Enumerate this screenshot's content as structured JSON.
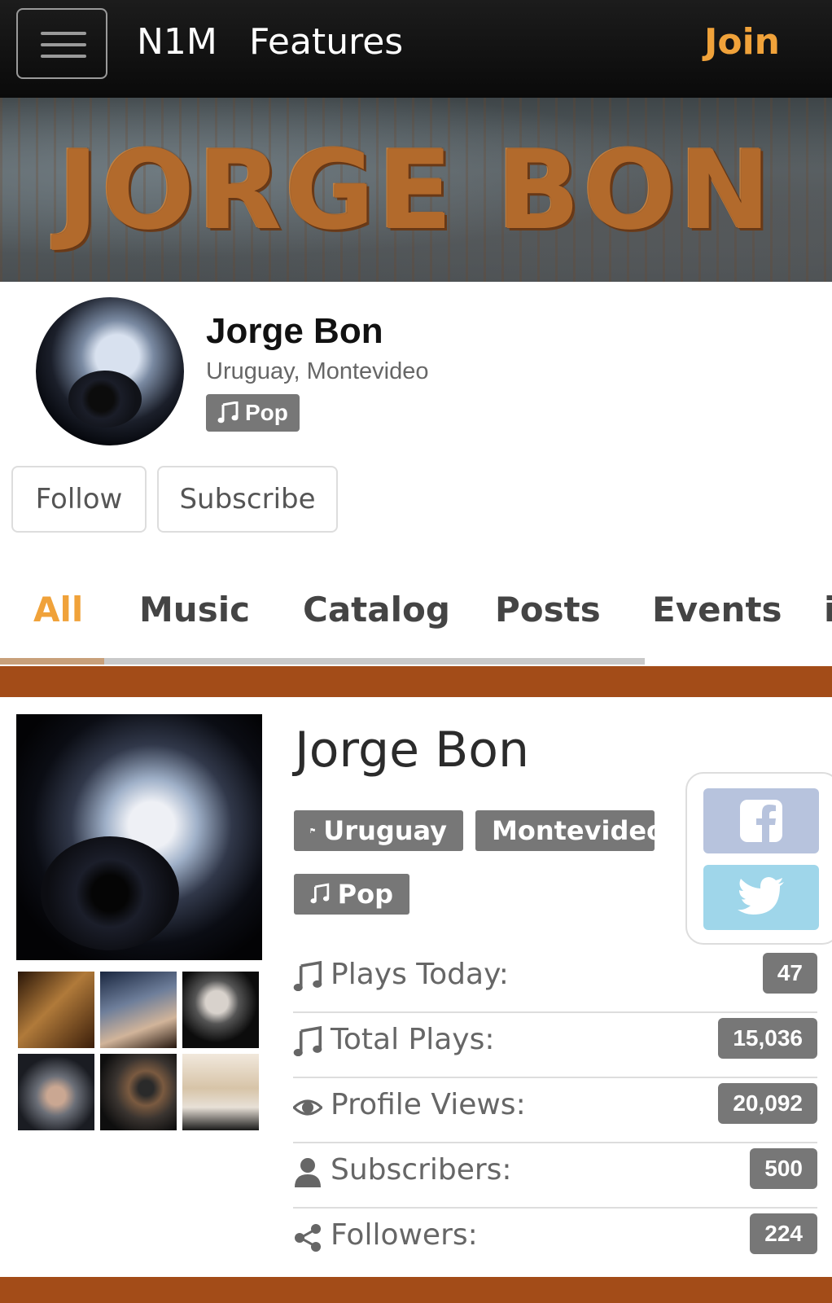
{
  "navbar": {
    "brand": "N1M",
    "features_label": "Features",
    "join_label": "Join"
  },
  "banner": {
    "title": "JORGE BON"
  },
  "profile": {
    "name": "Jorge Bon",
    "location": "Uruguay, Montevideo",
    "genre": "Pop",
    "follow_label": "Follow",
    "subscribe_label": "Subscribe"
  },
  "tabs": [
    {
      "label": "All",
      "active": true
    },
    {
      "label": "Music",
      "active": false
    },
    {
      "label": "Catalog",
      "active": false
    },
    {
      "label": "Posts",
      "active": false
    },
    {
      "label": "Events",
      "active": false
    },
    {
      "label": "i",
      "active": false
    }
  ],
  "artist": {
    "title": "Jorge Bon",
    "country": "Uruguay",
    "city": "Montevideo",
    "genre": "Pop"
  },
  "stats": [
    {
      "icon": "music-note-icon",
      "label": "Plays Today:",
      "value": "47"
    },
    {
      "icon": "music-note-icon",
      "label": "Total Plays:",
      "value": "15,036"
    },
    {
      "icon": "eye-icon",
      "label": "Profile Views:",
      "value": "20,092"
    },
    {
      "icon": "user-icon",
      "label": "Subscribers:",
      "value": "500"
    },
    {
      "icon": "share-icon",
      "label": "Followers:",
      "value": "224"
    }
  ],
  "social": [
    "facebook-icon",
    "twitter-icon"
  ],
  "colors": {
    "accent": "#f0a23a",
    "section_bar": "#a34c18",
    "badge": "#777777",
    "facebook": "#b7c3dd",
    "twitter": "#9fd6ea"
  }
}
